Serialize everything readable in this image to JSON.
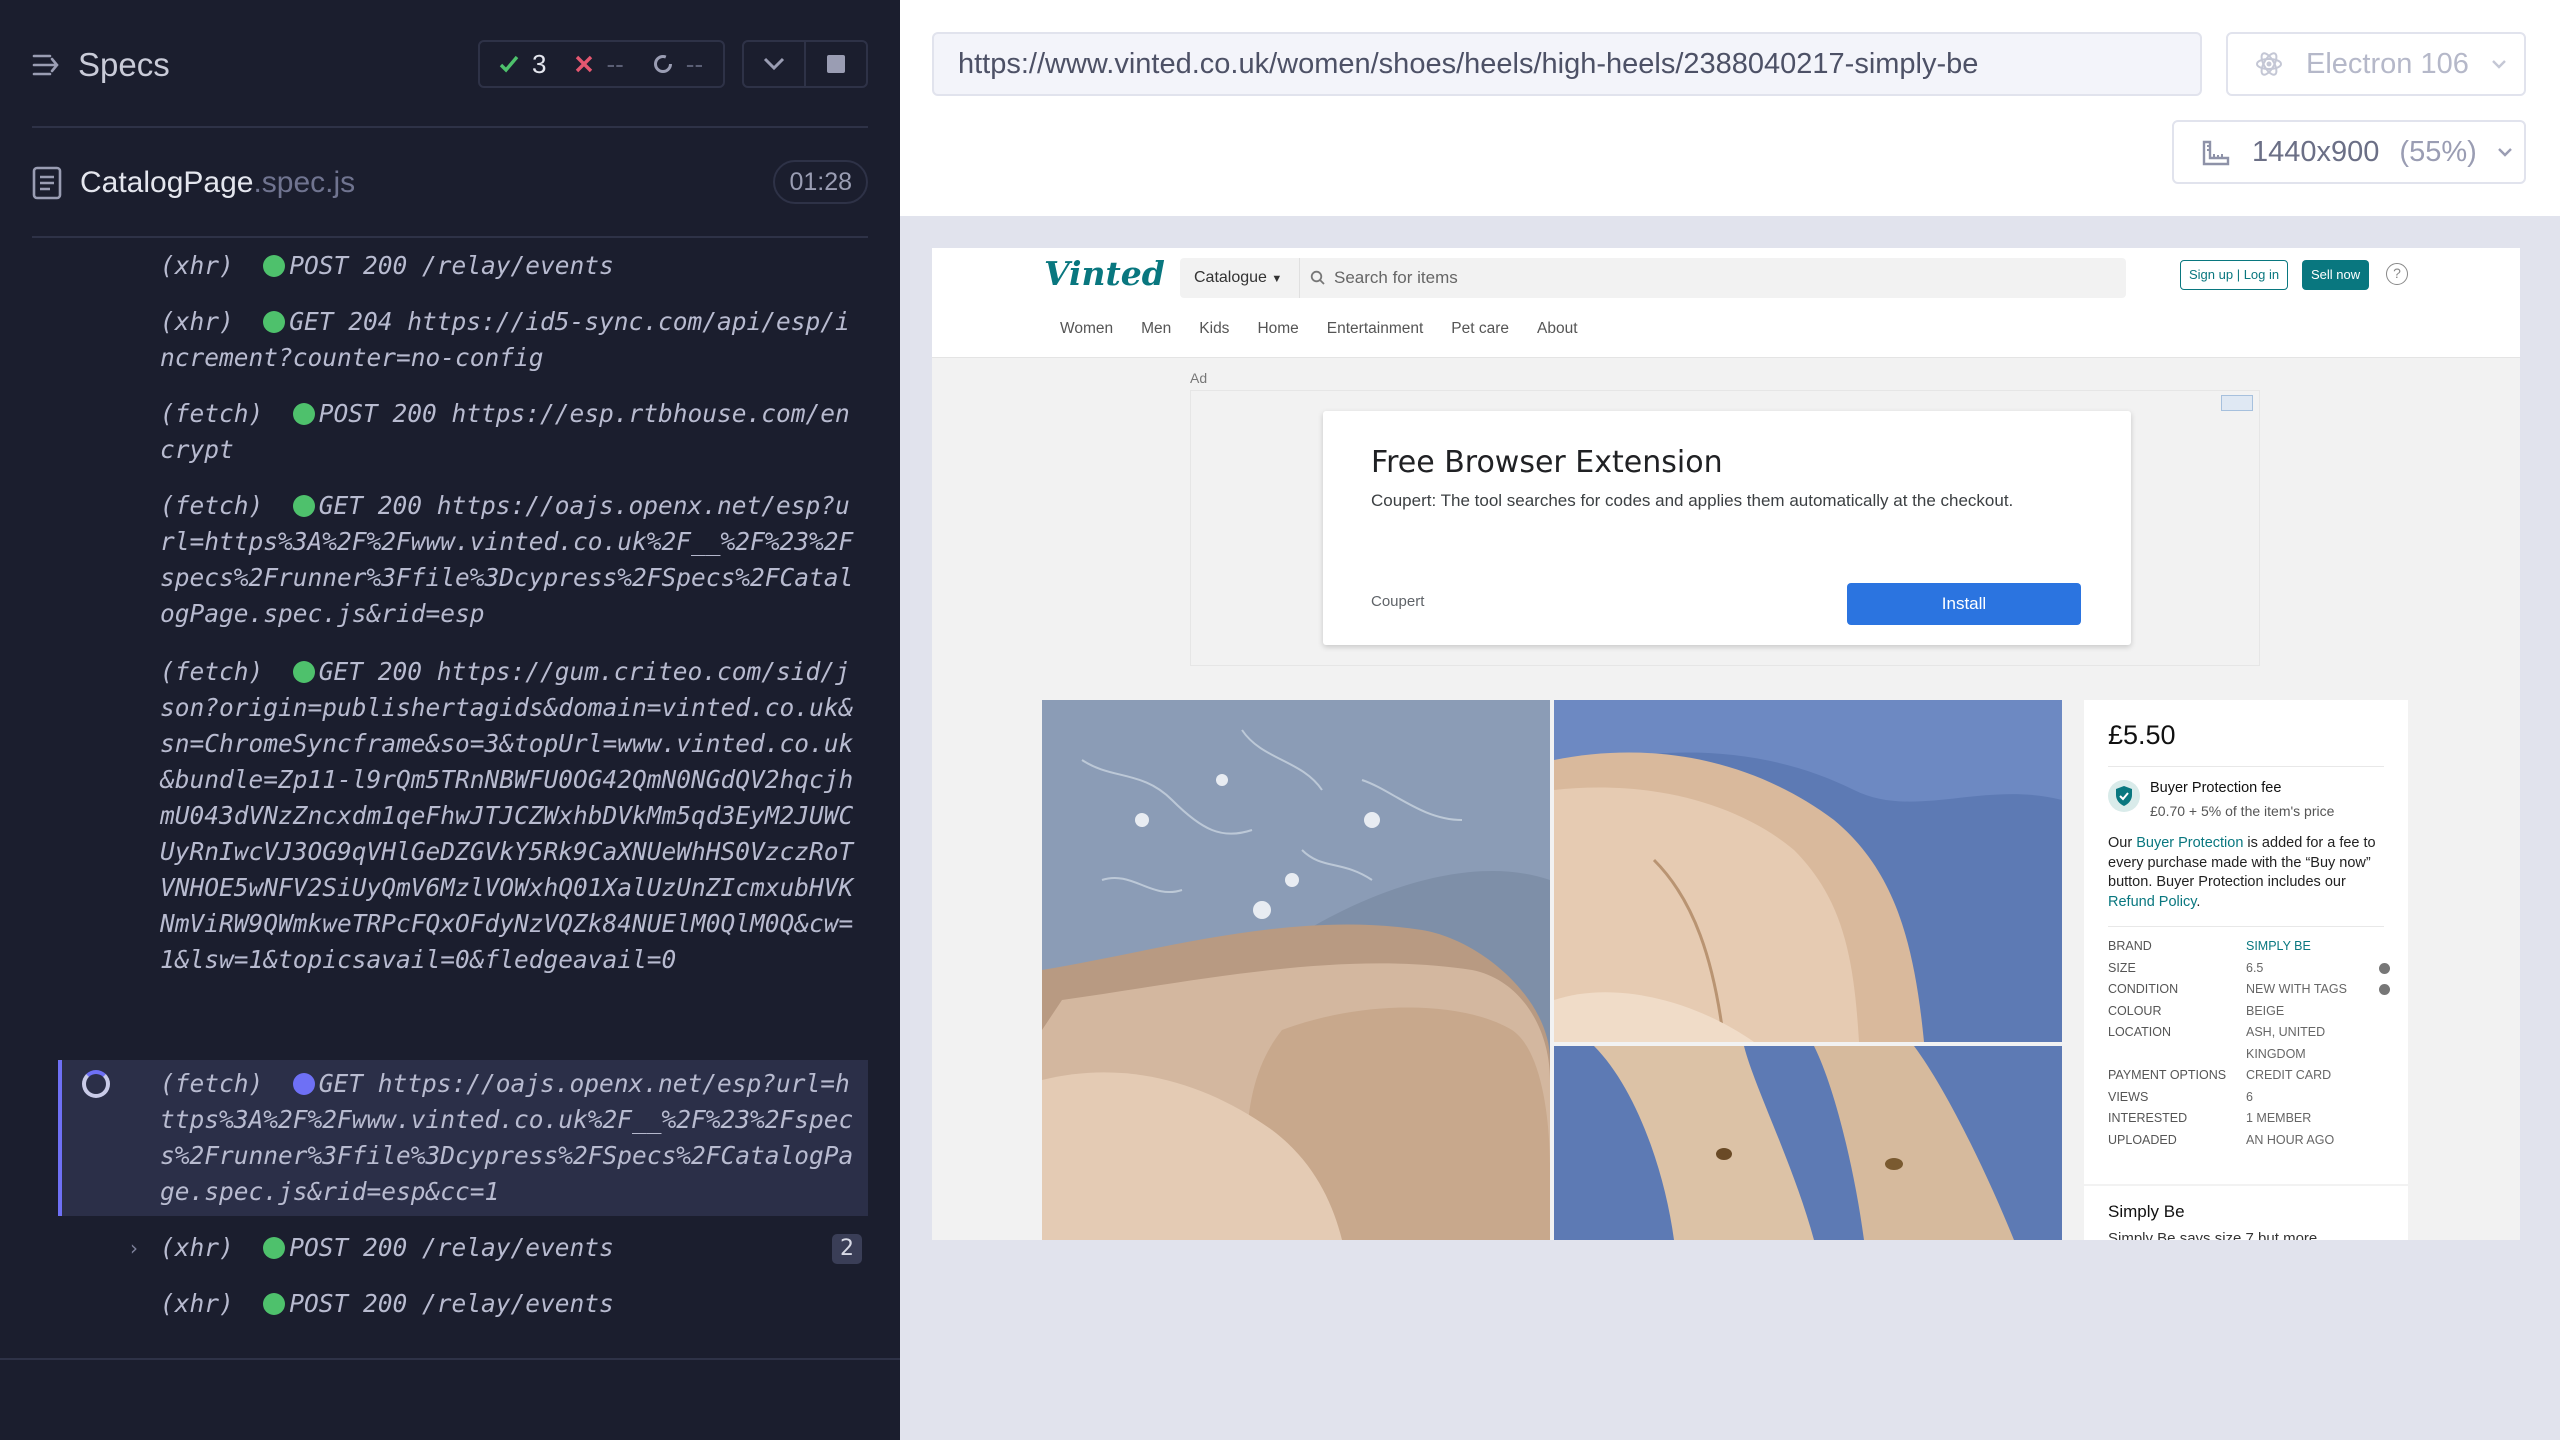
{
  "reporter": {
    "title": "Specs",
    "stats": {
      "passed": "3",
      "failed": "--",
      "pending": "--"
    },
    "spec": {
      "name": "CatalogPage",
      "ext": ".spec.js",
      "duration": "01:28"
    },
    "commands": [
      {
        "type": "(xhr)",
        "text": "POST 200 /relay/events",
        "status": "ok"
      },
      {
        "type": "(xhr)",
        "text": "GET 204 https://id5-sync.com/api/esp/increment?counter=no-config",
        "status": "ok"
      },
      {
        "type": "(fetch)",
        "text": "POST 200 https://esp.rtbhouse.com/encrypt",
        "status": "ok"
      },
      {
        "type": "(fetch)",
        "text": "GET 200 https://oajs.openx.net/esp?url=https%3A%2F%2Fwww.vinted.co.uk%2F__%2F%23%2Fspecs%2Frunner%3Ffile%3Dcypress%2FSpecs%2FCatalogPage.spec.js&rid=esp",
        "status": "ok"
      },
      {
        "type": "(fetch)",
        "text": "GET 200 https://gum.criteo.com/sid/json?origin=publishertagids&domain=vinted.co.uk&sn=ChromeSyncframe&so=3&topUrl=www.vinted.co.uk&bundle=Zp11-l9rQm5TRnNBWFU0OG42QmN0NGdQV2hqcjhmU043dVNzZncxdm1qeFhwJTJCZWxhbDVkMm5qd3EyM2JUWCUyRnIwcVJ3OG9qVHlGeDZGVkY5Rk9CaXNUeWhHS0VzczRoTVNHOE5wNFV2SiUyQmV6MzlVOWxhQ01XalUzUnZIcmxubHVKNmViRW9QWmkweTRPcFQxOFdyNzVQZk84NUElM0QlM0Q&cw=1&lsw=1&topicsavail=0&fledgeavail=0",
        "status": "ok"
      },
      {
        "type": "(fetch)",
        "text": "GET https://oajs.openx.net/esp?url=https%3A%2F%2Fwww.vinted.co.uk%2F__%2F%23%2Fspecs%2Frunner%3Ffile%3Dcypress%2FSpecs%2FCatalogPage.spec.js&rid=esp&cc=1",
        "status": "pending"
      },
      {
        "type": "(xhr)",
        "text": "POST 200 /relay/events",
        "status": "ok",
        "count": "2"
      },
      {
        "type": "(xhr)",
        "text": "POST 200 /relay/events",
        "status": "ok"
      }
    ]
  },
  "toolbar": {
    "url": "https://www.vinted.co.uk/women/shoes/heels/high-heels/2388040217-simply-be",
    "browser": "Electron 106",
    "viewport": "1440x900",
    "scale": "(55%)"
  },
  "site": {
    "logo": "Vinted",
    "catalogue": "Catalogue",
    "search_placeholder": "Search for items",
    "signup": "Sign up | Log in",
    "sell": "Sell now",
    "help": "?",
    "nav": [
      "Women",
      "Men",
      "Kids",
      "Home",
      "Entertainment",
      "Pet care",
      "About"
    ],
    "ad": {
      "label": "Ad",
      "title": "Free Browser Extension",
      "desc": "Coupert: The tool searches for codes and applies them automatically at the checkout.",
      "brand": "Coupert",
      "cta": "Install"
    },
    "item": {
      "price": "£5.50",
      "bp_title": "Buyer Protection fee",
      "bp_fee": "£0.70 + 5% of the item's price",
      "bp_text_before": "Our ",
      "bp_link": "Buyer Protection",
      "bp_text_middle": " is added for a fee to every purchase made with the “Buy now” button. Buyer Protection includes our ",
      "bp_link2": "Refund Policy",
      "bp_text_after": ".",
      "details": [
        {
          "k": "BRAND",
          "v": "SIMPLY BE"
        },
        {
          "k": "SIZE",
          "v": "6.5"
        },
        {
          "k": "CONDITION",
          "v": "NEW WITH TAGS"
        },
        {
          "k": "COLOUR",
          "v": "BEIGE"
        },
        {
          "k": "LOCATION",
          "v": "ASH, UNITED KINGDOM"
        },
        {
          "k": "PAYMENT OPTIONS",
          "v": "CREDIT CARD"
        },
        {
          "k": "VIEWS",
          "v": "6"
        },
        {
          "k": "INTERESTED",
          "v": "1 MEMBER"
        },
        {
          "k": "UPLOADED",
          "v": "AN HOUR AGO"
        }
      ],
      "seller_title": "Simply Be",
      "seller_desc": "Simply Be says size 7 but more"
    }
  },
  "colors": {
    "reporter_bg": "#1b1e2e",
    "pass": "#4ec16c",
    "fail": "#e45770",
    "pending": "#6e70f5",
    "vinted_teal": "#09777f"
  }
}
